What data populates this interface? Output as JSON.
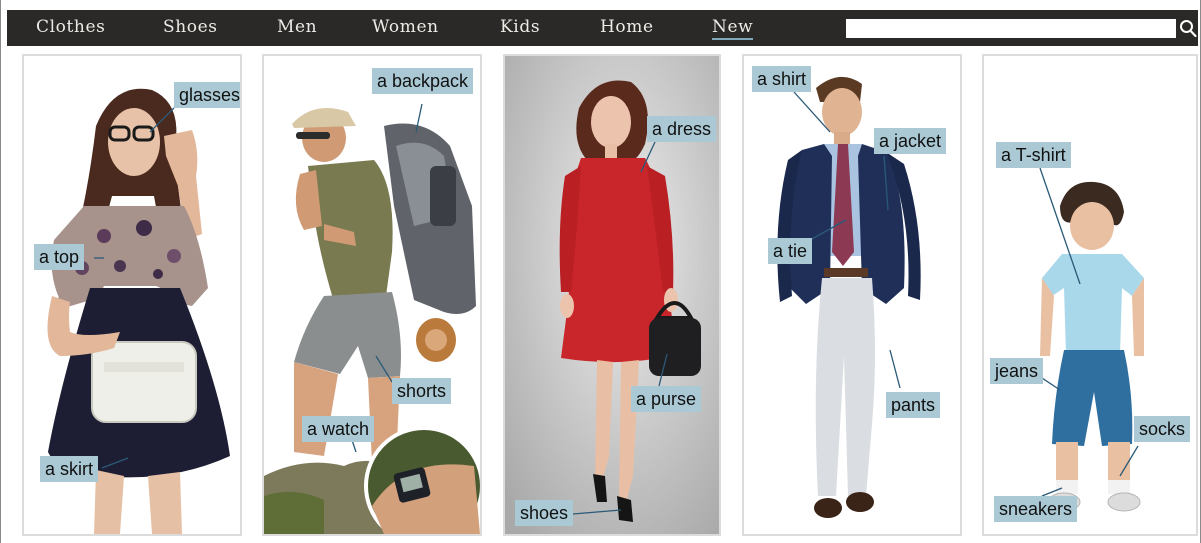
{
  "nav": {
    "items": [
      "Clothes",
      "Shoes",
      "Men",
      "Women",
      "Kids",
      "Home",
      "New"
    ],
    "active": "New"
  },
  "search": {
    "value": "",
    "placeholder": ""
  },
  "colors": {
    "nav_bg": "#2b2928",
    "nav_text": "#ecebe6",
    "nav_active_underline": "#7fa8b8",
    "tag_bg": "#aac9d4",
    "card_border": "#dcdcdc",
    "dress_red": "#c8262a",
    "jacket_navy": "#1f2f58"
  },
  "cards": [
    {
      "name": "woman-top-skirt",
      "labels": [
        "glasses",
        "a top",
        "a skirt"
      ]
    },
    {
      "name": "hiker",
      "labels": [
        "a backpack",
        "shorts",
        "a watch"
      ]
    },
    {
      "name": "woman-red-dress",
      "labels": [
        "a dress",
        "a purse",
        "shoes"
      ]
    },
    {
      "name": "man-suit",
      "labels": [
        "a shirt",
        "a jacket",
        "a tie",
        "pants"
      ]
    },
    {
      "name": "boy",
      "labels": [
        "a T-shirt",
        "jeans",
        "socks",
        "sneakers"
      ]
    }
  ],
  "icons": {
    "search": "search-icon"
  }
}
